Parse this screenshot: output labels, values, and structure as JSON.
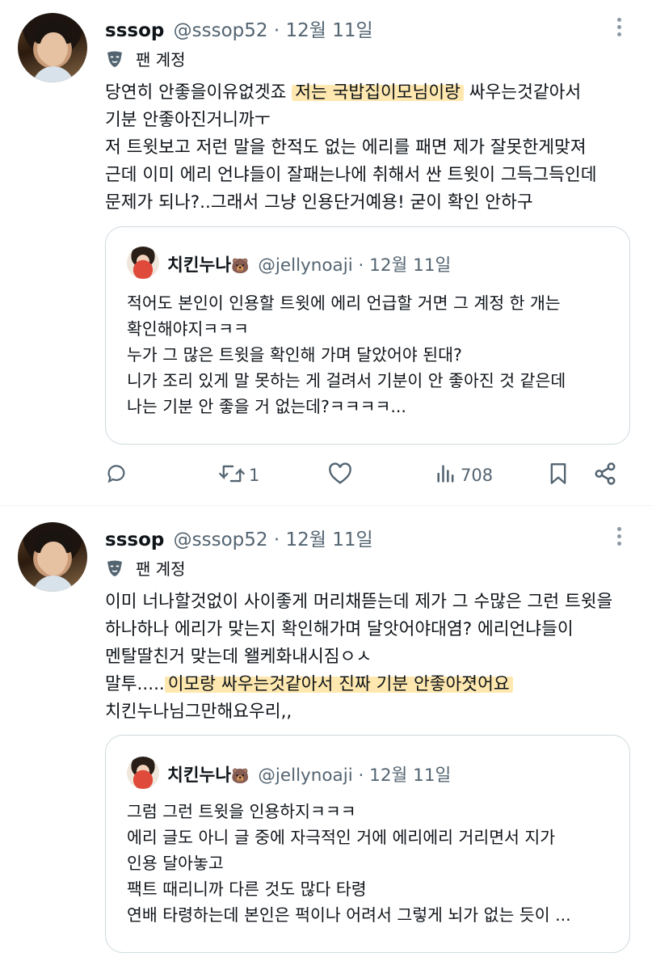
{
  "tweets": [
    {
      "name": "sssop",
      "handle": "@sssop52 · 12월 11일",
      "badge": "팬 계정",
      "lines": [
        "당연히 안좋을이유없겟죠 ",
        "기분 안좋아진거니까ㅜ",
        "저 트윗보고 저런 말을 한적도 없는 에리를 패면 제가 잘못한게맞져",
        "근데 이미 에리 언냐들이 잘패는나에 취해서 싼 트윗이 그득그득인데",
        "문제가 되나?..그래서 그냥 인용단거예용! 굳이 확인 안하구"
      ],
      "line1_highlight": "저는 국밥집이모님이랑",
      "line1_tail": " 싸우는것같아서",
      "quote": {
        "name": "치킨누나",
        "emoji": "🐻",
        "handle": "@jellynoaji · 12월 11일",
        "lines": [
          "적어도 본인이 인용할 트윗에 에리 언급할 거면 그 계정 한 개는",
          "확인해야지ㅋㅋㅋ",
          "누가 그 많은 트윗을 확인해 가며 달았어야 된대?",
          "니가 조리 있게 말 못하는 게 걸려서 기분이 안 좋아진 것 같은데",
          "나는 기분 안 좋을 거 없는데?ㅋㅋㅋㅋ..."
        ]
      },
      "actions": {
        "reply": "",
        "retweet": "1",
        "like": "",
        "views": "708"
      }
    },
    {
      "name": "sssop",
      "handle": "@sssop52 · 12월 11일",
      "badge": "팬 계정",
      "lines": [
        "이미 너나할것없이 사이좋게 머리채뜯는데 제가 그 수많은 그런 트윗을",
        "하나하나 에리가 맞는지 확인해가며 달앗어야대염? 에리언냐들이",
        "멘탈딸친거 맞는데 왤케화내시짐ㅇㅅ",
        "말투.....",
        "치킨누나님그만해요우리,,"
      ],
      "line4_highlight": "이모랑 싸우는것같아서 진짜 기분 안좋아졋어요",
      "quote": {
        "name": "치킨누나",
        "emoji": "🐻",
        "handle": "@jellynoaji · 12월 11일",
        "lines": [
          "그럼 그런 트윗을 인용하지ㅋㅋㅋ",
          "에리 글도 아니  글 중에 자극적인 거에 에리에리 거리면서 지가",
          "인용 달아놓고",
          "팩트 때리니까 다른 것도 많다 타령",
          "연배 타령하는데 본인은 퍽이나 어려서 그렇게 뇌가 없는 듯이 ..."
        ]
      }
    }
  ],
  "icons": {
    "reply": "reply-icon",
    "retweet": "retweet-icon",
    "like": "heart-icon",
    "views": "views-icon",
    "bookmark": "bookmark-icon",
    "share": "share-icon",
    "more": "more-icon",
    "fan": "mask-icon"
  },
  "colors": {
    "highlight": "#ffd66e",
    "muted": "#536471",
    "border": "#cfd9de"
  }
}
